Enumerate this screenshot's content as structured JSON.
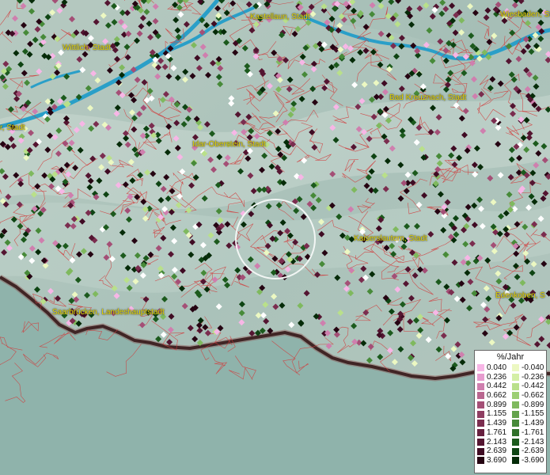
{
  "map": {
    "cities": [
      {
        "id": "kastellaun",
        "label": "Kastellaun, Stadt"
      },
      {
        "id": "wiesbaden",
        "label": "Wiesbaden, St"
      },
      {
        "id": "wittlich",
        "label": "Wittlich, Stadt"
      },
      {
        "id": "bad-kreuznach",
        "label": "Bad Kreuznach, Stadt"
      },
      {
        "id": "trier",
        "label": "r, Stadt"
      },
      {
        "id": "idar-oberstein",
        "label": "Idar-Oberstein, Stadt"
      },
      {
        "id": "kaiserslautern",
        "label": "Kaiserslautern, Stadt"
      },
      {
        "id": "edenkoben",
        "label": "Edenkoben, S"
      },
      {
        "id": "saarbruecken",
        "label": "Saarbrücken, Landeshauptstadt"
      }
    ],
    "colors": {
      "background": "#a9c3bd",
      "boundary": "#d23a3a",
      "river": "#2a9fc8",
      "lowland": "#8fb3ab"
    }
  },
  "legend": {
    "title": "%/Jahr",
    "positive": [
      {
        "value": "0.040",
        "color": "#f7b6e6"
      },
      {
        "value": "0.236",
        "color": "#e79ccf"
      },
      {
        "value": "0.442",
        "color": "#cf7fae"
      },
      {
        "value": "0.662",
        "color": "#b9668f"
      },
      {
        "value": "0.899",
        "color": "#a44f76"
      },
      {
        "value": "1.155",
        "color": "#8f3e62"
      },
      {
        "value": "1.439",
        "color": "#7b2d4f"
      },
      {
        "value": "1.761",
        "color": "#67203f"
      },
      {
        "value": "2.143",
        "color": "#541531"
      },
      {
        "value": "2.639",
        "color": "#3f0b23"
      },
      {
        "value": "3.690",
        "color": "#250412"
      }
    ],
    "negative": [
      {
        "value": "-0.040",
        "color": "#ecf8c2"
      },
      {
        "value": "-0.236",
        "color": "#d4efa5"
      },
      {
        "value": "-0.442",
        "color": "#b9e08a"
      },
      {
        "value": "-0.662",
        "color": "#9ccf73"
      },
      {
        "value": "-0.899",
        "color": "#7fb95e"
      },
      {
        "value": "-1.155",
        "color": "#63a34b"
      },
      {
        "value": "-1.439",
        "color": "#478a39"
      },
      {
        "value": "-1.761",
        "color": "#2f7029"
      },
      {
        "value": "-2.143",
        "color": "#1c5a1d"
      },
      {
        "value": "-2.639",
        "color": "#0e4413"
      },
      {
        "value": "-3.690",
        "color": "#052b08"
      }
    ]
  }
}
